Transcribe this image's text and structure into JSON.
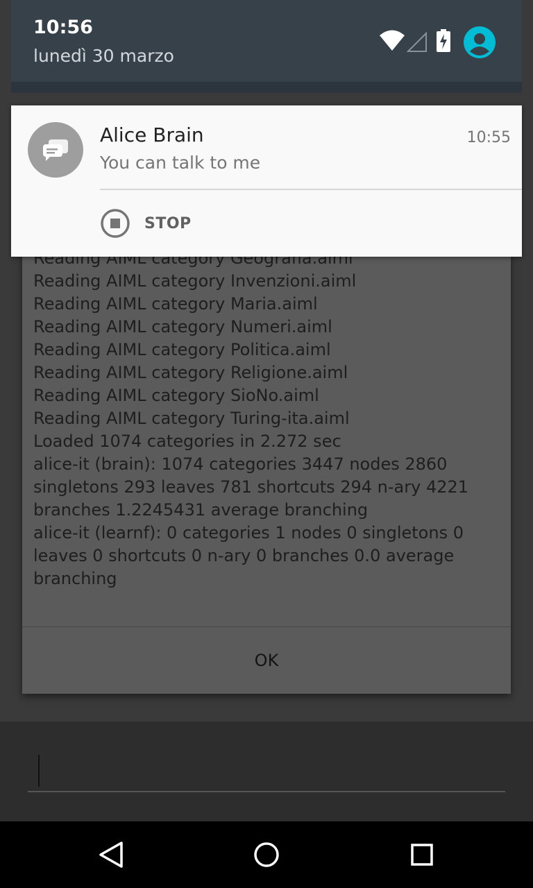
{
  "status": {
    "time": "10:56",
    "date": "lunedì 30 marzo",
    "icons": [
      "wifi-icon",
      "signal-icon",
      "battery-charging-icon",
      "user-icon"
    ],
    "accent": "#00bcd4"
  },
  "notification": {
    "title": "Alice Brain",
    "time": "10:55",
    "text": "You can talk to me",
    "action_label": "STOP",
    "icon": "chat-icon"
  },
  "dialog": {
    "lines": [
      "Reading AIML category Geografia.aiml",
      "Reading AIML category Invenzioni.aiml",
      "Reading AIML category Maria.aiml",
      "Reading AIML category Numeri.aiml",
      "Reading AIML category Politica.aiml",
      "Reading AIML category Religione.aiml",
      "Reading AIML category SioNo.aiml",
      "Reading AIML category Turing-ita.aiml",
      "Loaded 1074 categories in 2.272 sec",
      "alice-it (brain): 1074 categories 3447 nodes 2860 singletons 293 leaves 781 shortcuts 294 n-ary 4221 branches 1.2245431 average branching",
      "alice-it (learnf): 0 categories 1 nodes 0 singletons 0 leaves 0 shortcuts 0 n-ary 0 branches 0.0 average branching"
    ],
    "ok_label": "OK"
  },
  "nav": {
    "back": "back-icon",
    "home": "home-icon",
    "recents": "recents-icon"
  }
}
